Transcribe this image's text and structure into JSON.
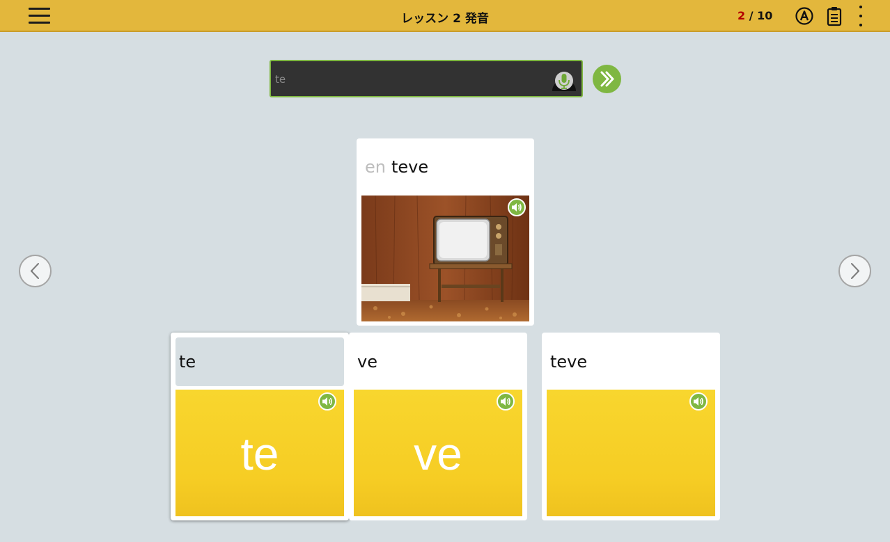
{
  "header": {
    "title": "レッスン 2 発音",
    "progress_current": "2",
    "progress_sep": " / ",
    "progress_total": "10",
    "icons": [
      "menu-icon",
      "auto-play-a-icon",
      "clipboard-icon",
      "more-vertical-icon"
    ]
  },
  "answer": {
    "value": "te",
    "mic_icon": "microphone-icon",
    "submit_icon": "double-chevron-right-icon"
  },
  "navigation": {
    "prev_icon": "chevron-left-icon",
    "next_icon": "chevron-right-icon"
  },
  "prompt_card": {
    "article": "en",
    "word": "teve",
    "image": "retro-television-photo",
    "audio_icon": "speaker-icon"
  },
  "options": [
    {
      "label": "te",
      "tile_text": "te",
      "selected": true
    },
    {
      "label": "ve",
      "tile_text": "ve",
      "selected": false
    },
    {
      "label": "teve",
      "tile_text": "",
      "selected": false
    }
  ],
  "colors": {
    "header_bg": "#e3b73c",
    "accent_green": "#7fb742",
    "page_bg": "#d6dee2",
    "tile_yellow": "#f7d12a",
    "progress_current": "#b30000"
  }
}
